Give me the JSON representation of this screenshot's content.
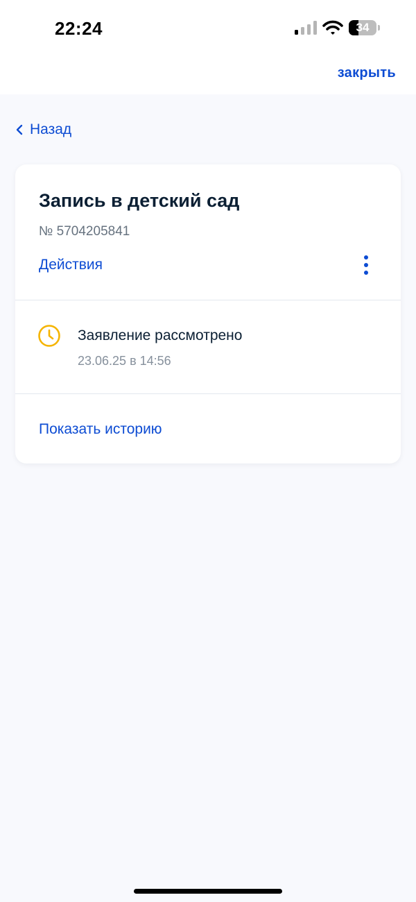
{
  "status_bar": {
    "time": "22:24",
    "battery_level": "34",
    "battery_fraction": 0.34,
    "signal_icon": "cellular-signal-icon",
    "wifi_icon": "wifi-icon",
    "battery_icon": "battery-icon"
  },
  "header": {
    "close_label": "закрыть"
  },
  "nav": {
    "back_label": "Назад",
    "back_icon": "chevron-left-icon"
  },
  "card": {
    "title": "Запись в детский сад",
    "number": "№ 5704205841",
    "actions_label": "Действия",
    "more_icon": "more-vertical-icon",
    "status": {
      "icon": "clock-icon",
      "text": "Заявление рассмотрено",
      "date": "23.06.25 в 14:56"
    },
    "history_label": "Показать историю"
  },
  "colors": {
    "accent": "#0d4cd3",
    "status_icon": "#f5b400",
    "background": "#f8f9fd",
    "card": "#ffffff"
  }
}
